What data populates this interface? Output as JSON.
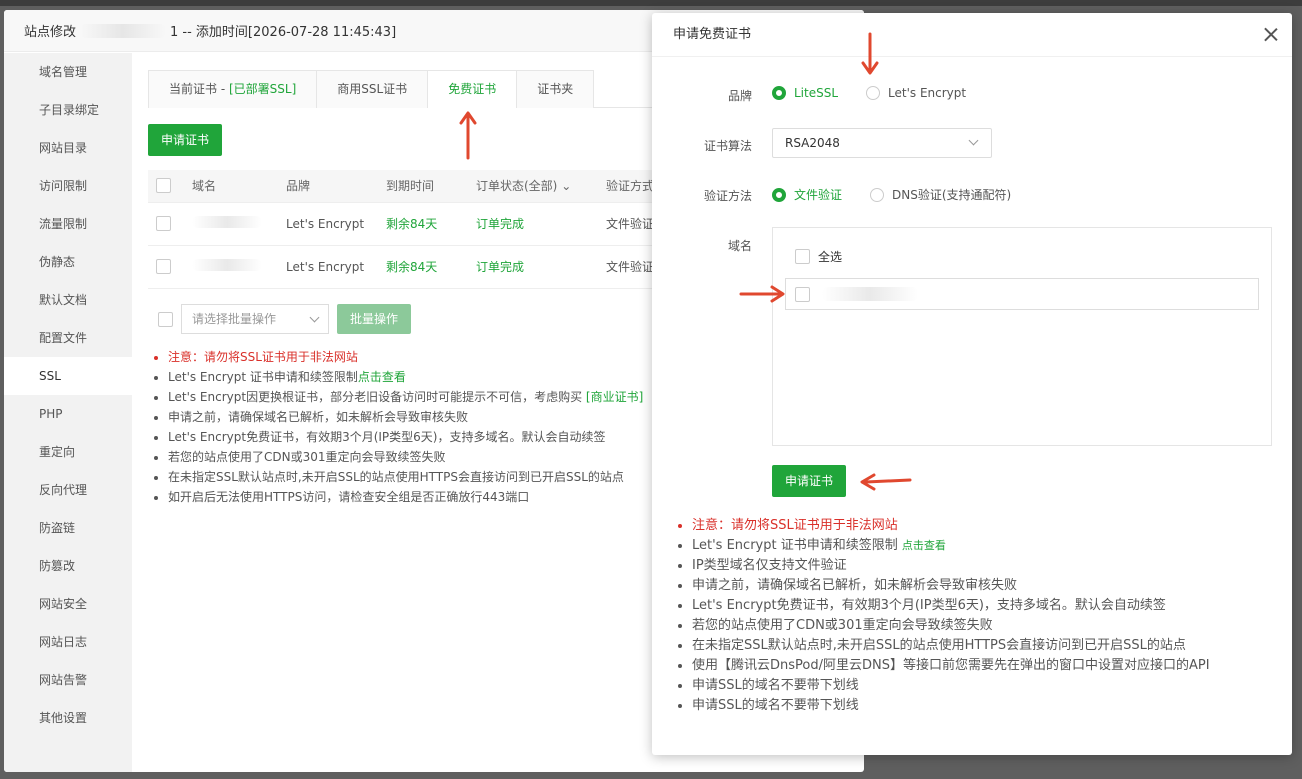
{
  "site_window": {
    "title_prefix": "站点修改",
    "title_suffix": "1 -- 添加时间[2026-07-28 11:45:43]",
    "sidebar": [
      {
        "label": "域名管理"
      },
      {
        "label": "子目录绑定"
      },
      {
        "label": "网站目录"
      },
      {
        "label": "访问限制"
      },
      {
        "label": "流量限制"
      },
      {
        "label": "伪静态"
      },
      {
        "label": "默认文档"
      },
      {
        "label": "配置文件"
      },
      {
        "label": "SSL"
      },
      {
        "label": "PHP"
      },
      {
        "label": "重定向"
      },
      {
        "label": "反向代理"
      },
      {
        "label": "防盗链"
      },
      {
        "label": "防篡改"
      },
      {
        "label": "网站安全"
      },
      {
        "label": "网站日志"
      },
      {
        "label": "网站告警"
      },
      {
        "label": "其他设置"
      }
    ],
    "active_sidebar": "SSL",
    "tabs": {
      "current_prefix": "当前证书 - ",
      "current_status": "[已部署SSL]",
      "commercial": "商用SSL证书",
      "free": "免费证书",
      "folder": "证书夹"
    },
    "apply_button": "申请证书",
    "table": {
      "headers": [
        "域名",
        "品牌",
        "到期时间",
        "订单状态(全部)",
        "验证方式"
      ],
      "rows": [
        {
          "brand": "Let's Encrypt",
          "expire": "剩余84天",
          "status": "订单完成",
          "method": "文件验证"
        },
        {
          "brand": "Let's Encrypt",
          "expire": "剩余84天",
          "status": "订单完成",
          "method": "文件验证"
        }
      ]
    },
    "batch": {
      "placeholder": "请选择批量操作",
      "button": "批量操作"
    },
    "notes": {
      "n1": "注意：请勿将SSL证书用于非法网站",
      "n2": "Let's Encrypt 证书申请和续签限制",
      "n2_link": "点击查看",
      "n3": "Let's Encrypt因更换根证书，部分老旧设备访问时可能提示不可信，考虑购买",
      "n3_link": "[商业证书]",
      "n4": "申请之前，请确保域名已解析，如未解析会导致审核失败",
      "n5": "Let's Encrypt免费证书，有效期3个月(IP类型6天)，支持多域名。默认会自动续签",
      "n6": "若您的站点使用了CDN或301重定向会导致续签失败",
      "n7": "在未指定SSL默认站点时,未开启SSL的站点使用HTTPS会直接访问到已开启SSL的站点",
      "n8": "如开启后无法使用HTTPS访问，请检查安全组是否正确放行443端口"
    }
  },
  "dialog": {
    "title": "申请免费证书",
    "brand_label": "品牌",
    "brand_options": [
      "LiteSSL",
      "Let's Encrypt"
    ],
    "brand_selected": "LiteSSL",
    "algo_label": "证书算法",
    "algo_value": "RSA2048",
    "verify_label": "验证方法",
    "verify_options": [
      "文件验证",
      "DNS验证(支持通配符)"
    ],
    "verify_selected": "文件验证",
    "domain_label": "域名",
    "select_all": "全选",
    "apply_button": "申请证书",
    "notes": {
      "n1": "注意：请勿将SSL证书用于非法网站",
      "n2": "Let's Encrypt 证书申请和续签限制",
      "n2_link": "点击查看",
      "n3": "IP类型域名仅支持文件验证",
      "n4": "申请之前，请确保域名已解析，如未解析会导致审核失败",
      "n5": "Let's Encrypt免费证书，有效期3个月(IP类型6天)，支持多域名。默认会自动续签",
      "n6": "若您的站点使用了CDN或301重定向会导致续签失败",
      "n7": "在未指定SSL默认站点时,未开启SSL的站点使用HTTPS会直接访问到已开启SSL的站点",
      "n8": "使用【腾讯云DnsPod/阿里云DNS】等接口前您需要先在弹出的窗口中设置对应接口的API",
      "n9": "申请SSL的域名不要带下划线",
      "n10": "申请SSL的域名不要带下划线"
    }
  },
  "colors": {
    "accent": "#20a53a",
    "warning": "#d9302a",
    "arrow": "#e0482f"
  }
}
